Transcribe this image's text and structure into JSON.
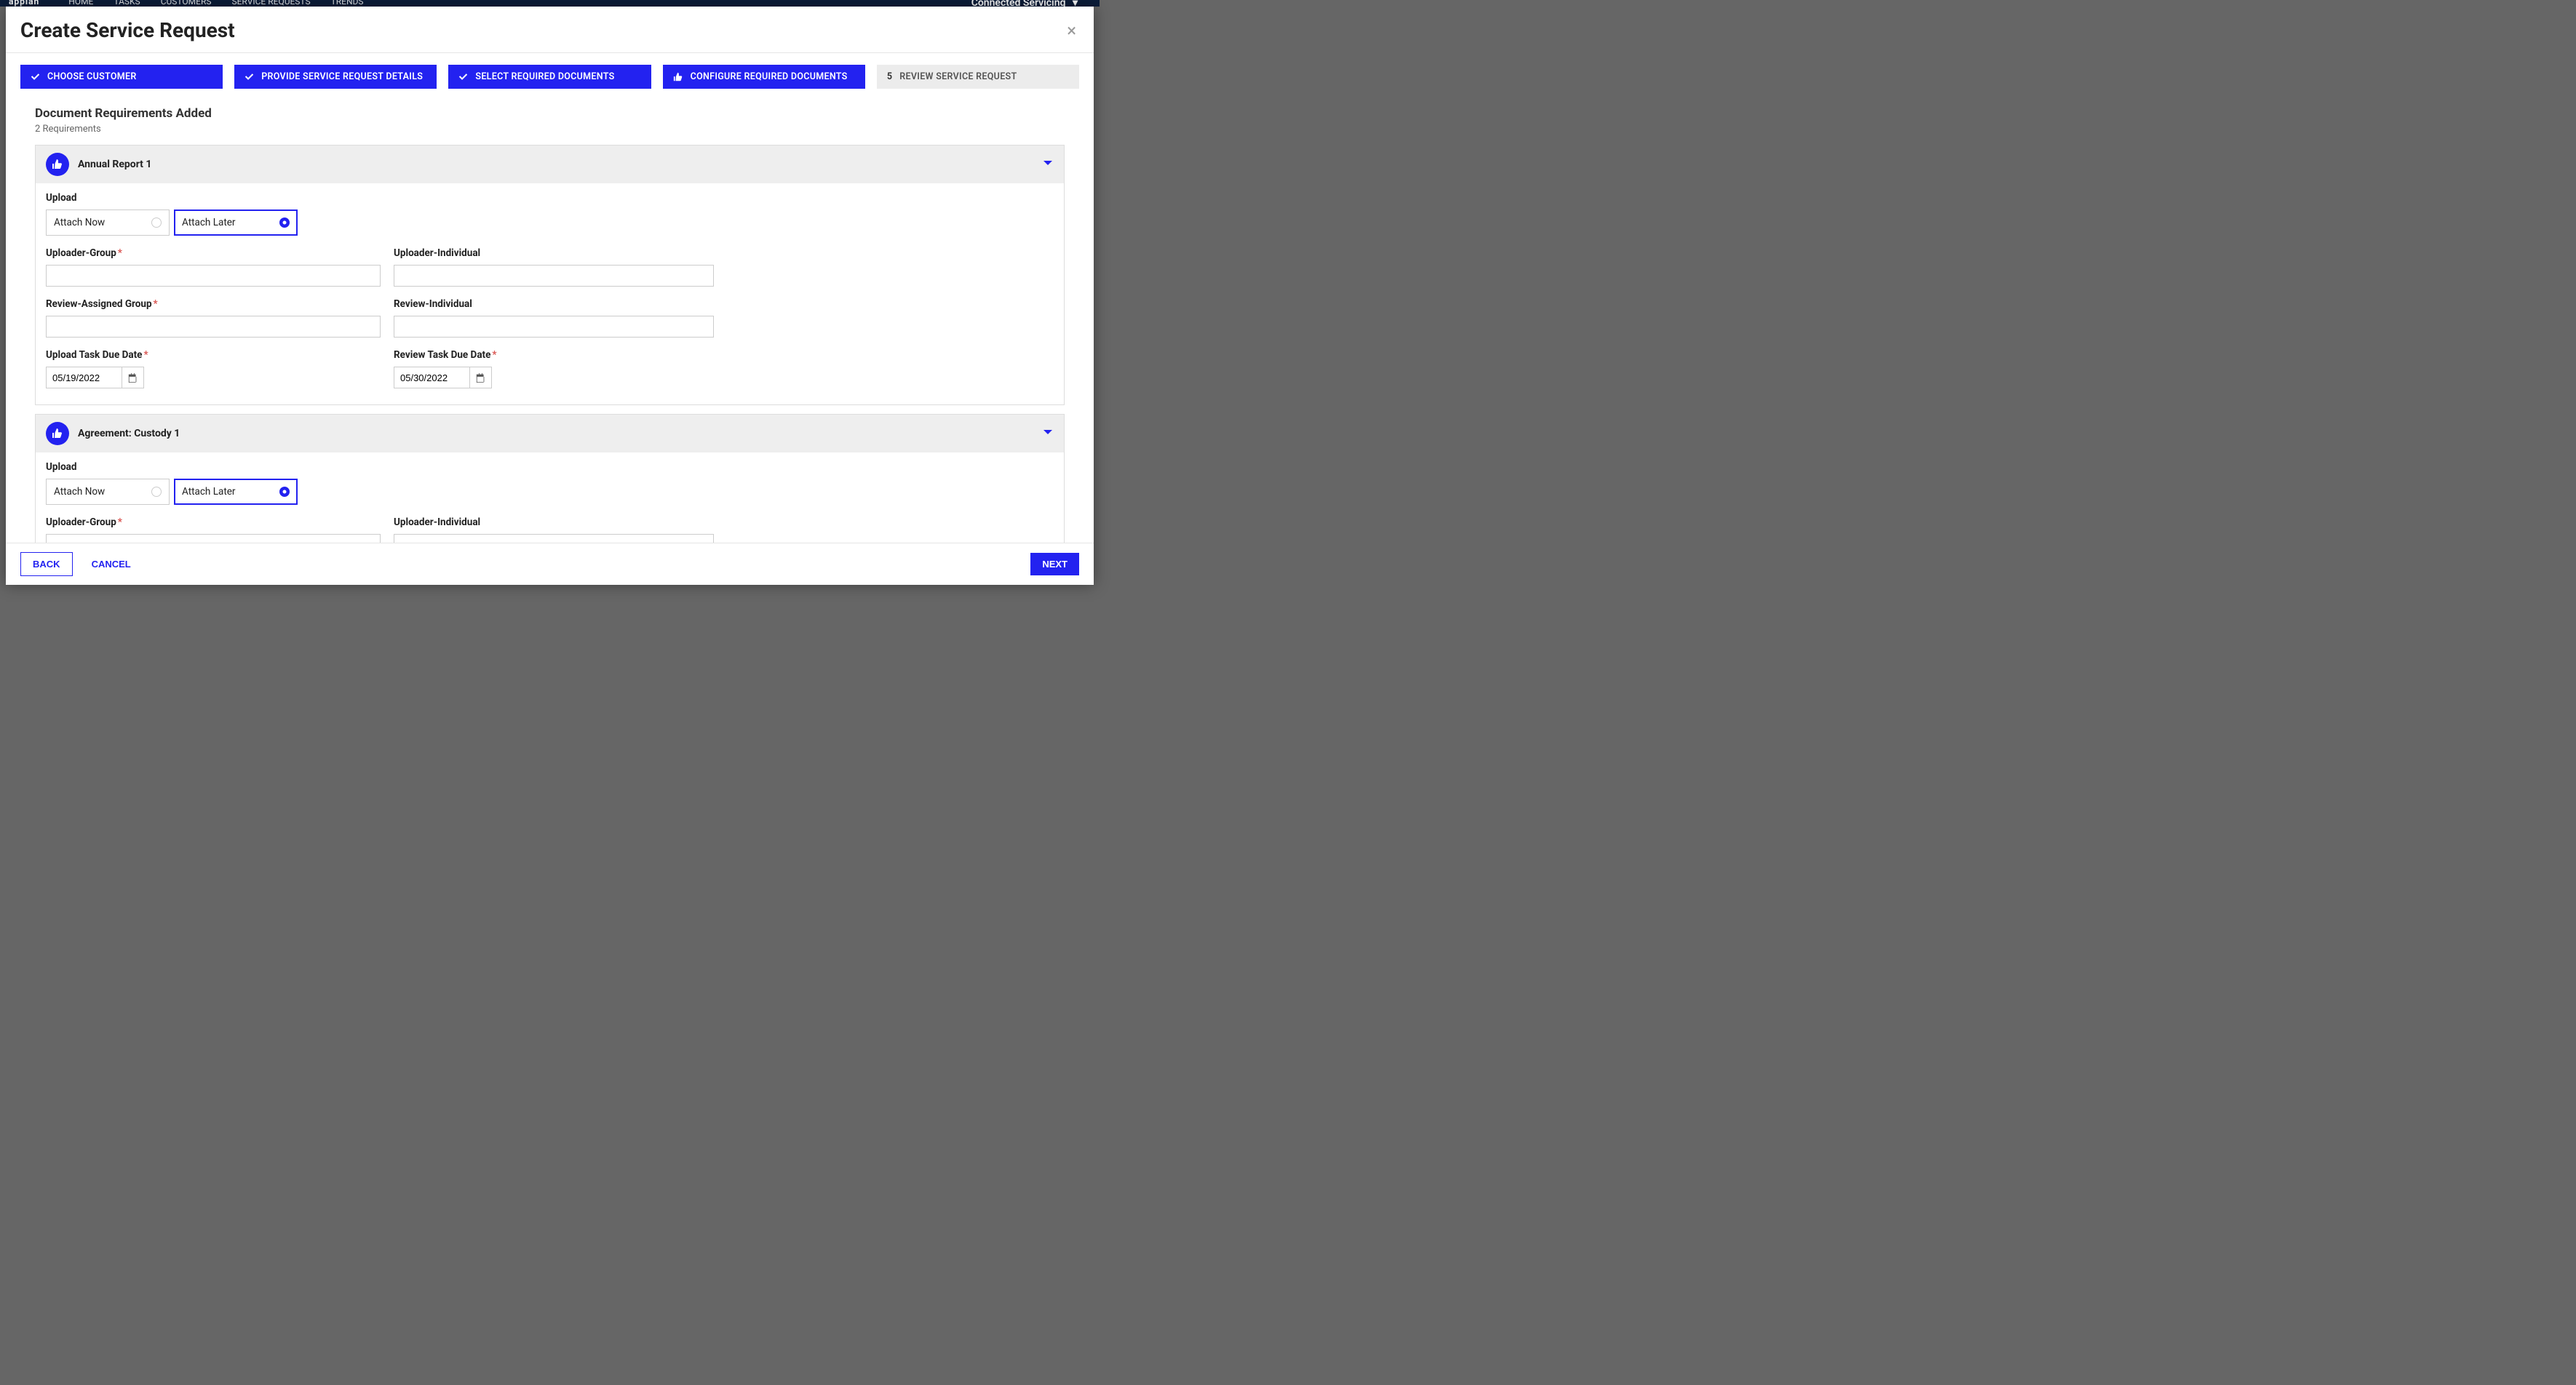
{
  "topbar": {
    "logo": "appian",
    "nav": [
      "HOME",
      "TASKS",
      "CUSTOMERS",
      "SERVICE REQUESTS",
      "TRENDS"
    ],
    "right_label": "Connected Servicing"
  },
  "modal": {
    "title": "Create Service Request",
    "close_icon": "×"
  },
  "steps": [
    {
      "label": "CHOOSE CUSTOMER",
      "done": true
    },
    {
      "label": "PROVIDE SERVICE REQUEST DETAILS",
      "done": true
    },
    {
      "label": "SELECT REQUIRED DOCUMENTS",
      "done": true
    },
    {
      "label": "CONFIGURE REQUIRED DOCUMENTS",
      "done": false,
      "active": true
    },
    {
      "num": "5",
      "label": "REVIEW SERVICE REQUEST",
      "pending": true
    }
  ],
  "section": {
    "title": "Document Requirements Added",
    "subtitle": "2 Requirements"
  },
  "labels": {
    "upload": "Upload",
    "attach_now": "Attach Now",
    "attach_later": "Attach Later",
    "uploader_group": "Uploader-Group",
    "uploader_individual": "Uploader-Individual",
    "review_assigned_group": "Review-Assigned Group",
    "review_individual": "Review-Individual",
    "upload_due": "Upload Task Due Date",
    "review_due": "Review Task Due Date"
  },
  "docs": [
    {
      "title": "Annual Report 1",
      "upload_mode": "later",
      "uploader_group": "",
      "uploader_individual": "",
      "review_group": "",
      "review_individual": "",
      "upload_due": "05/19/2022",
      "review_due": "05/30/2022"
    },
    {
      "title": "Agreement: Custody 1",
      "upload_mode": "later",
      "uploader_group": "",
      "uploader_individual": "",
      "review_group": "",
      "review_individual": "",
      "upload_due": "",
      "review_due": ""
    }
  ],
  "footer": {
    "back": "BACK",
    "cancel": "CANCEL",
    "next": "NEXT"
  }
}
